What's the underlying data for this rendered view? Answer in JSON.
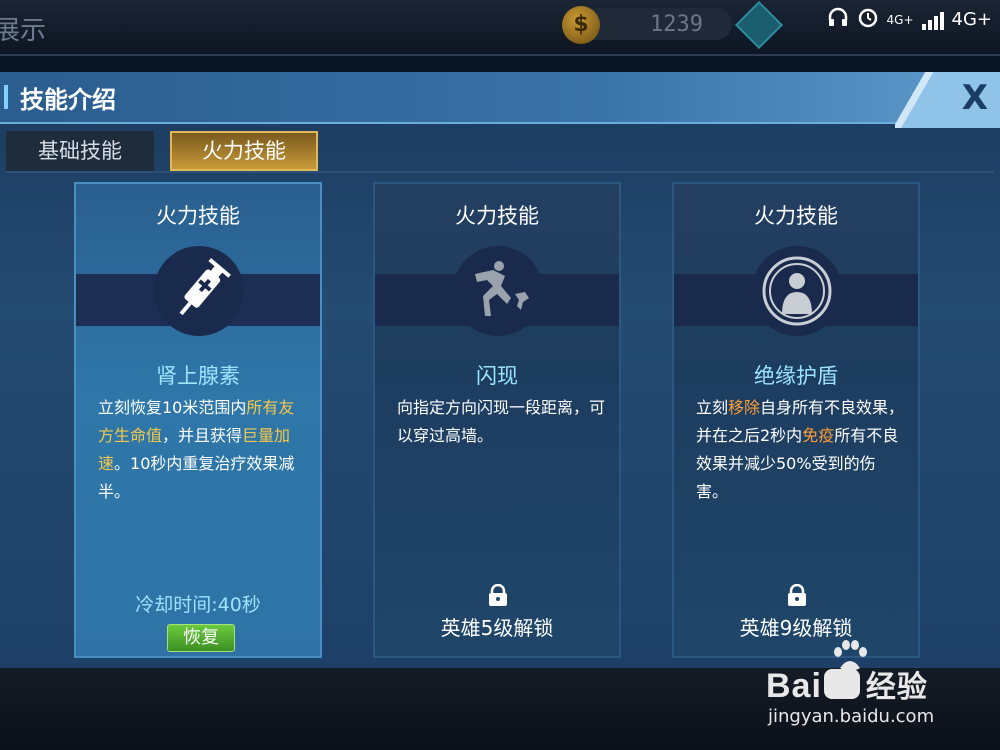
{
  "topbar": {
    "title_fragment": "展示",
    "coin_symbol": "$",
    "coin_count": "1239",
    "status": {
      "net1": "4G+",
      "net2": "4G+"
    }
  },
  "panel": {
    "title": "技能介绍",
    "close_label": "X",
    "tabs": [
      {
        "label": "基础技能",
        "active": false
      },
      {
        "label": "火力技能",
        "active": true
      }
    ]
  },
  "cards": [
    {
      "type": "火力技能",
      "name": "肾上腺素",
      "desc_parts": [
        "立刻恢复10米范围内",
        "所有友方生命值",
        "，并且获得",
        "巨量加速",
        "。10秒内重复治疗效果减半。"
      ],
      "cooldown": "冷却时间:40秒",
      "button": "恢复",
      "icon": "syringe-icon"
    },
    {
      "type": "火力技能",
      "name": "闪现",
      "desc": "向指定方向闪现一段距离，可以穿过高墙。",
      "unlock": "英雄5级解锁",
      "icon": "dash-icon"
    },
    {
      "type": "火力技能",
      "name": "绝缘护盾",
      "desc_parts": [
        "立刻",
        "移除",
        "自身所有不良效果，并在之后2秒内",
        "免疫",
        "所有不良效果并减少50%受到的伤害。"
      ],
      "unlock": "英雄9级解锁",
      "icon": "shield-person-icon"
    }
  ],
  "watermark": {
    "logo_left": "Bai",
    "logo_right": "经验",
    "url": "jingyan.baidu.com"
  },
  "colors": {
    "accent_gold": "#f5c84a",
    "accent_orange": "#ff9d36",
    "skill_name": "#9be4ff",
    "button_green": "#4fa92e"
  }
}
